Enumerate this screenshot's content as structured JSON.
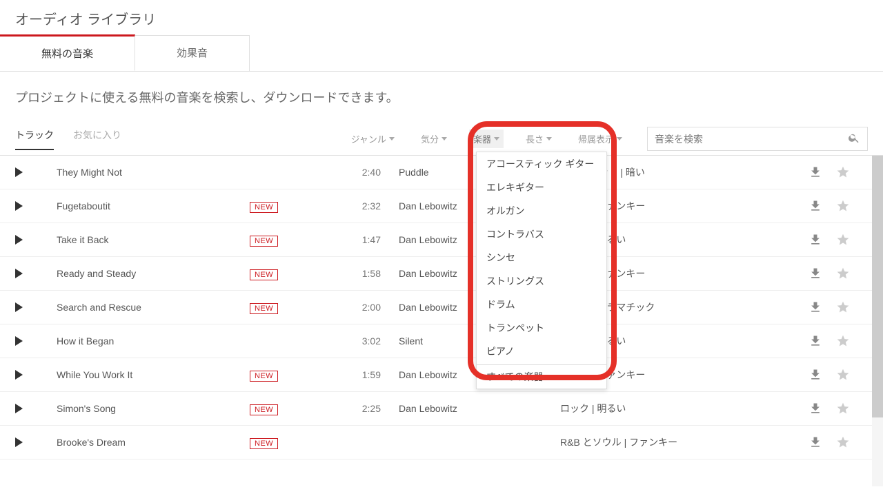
{
  "page_title": "オーディオ ライブラリ",
  "tabs": [
    {
      "label": "無料の音楽",
      "active": true
    },
    {
      "label": "効果音",
      "active": false
    }
  ],
  "intro": "プロジェクトに使える無料の音楽を検索し、ダウンロードできます。",
  "sub_tabs": [
    {
      "label": "トラック",
      "active": true
    },
    {
      "label": "お気に入り",
      "active": false
    }
  ],
  "filters": {
    "genre": "ジャンル",
    "mood": "気分",
    "instrument": "楽器",
    "length": "長さ",
    "license": "帰属表示"
  },
  "search_placeholder": "音楽を検索",
  "instrument_menu": [
    "アコースティック ギター",
    "エレキギター",
    "オルガン",
    "コントラバス",
    "シンセ",
    "ストリングス",
    "ドラム",
    "トランペット",
    "ピアノ"
  ],
  "instrument_menu_all": "すべての楽器",
  "tracks": [
    {
      "title": "They Might Not",
      "new": false,
      "duration": "2:40",
      "artist": "Puddle",
      "tags": "アンビエント | 暗い"
    },
    {
      "title": "Fugetaboutit",
      "new": true,
      "duration": "2:32",
      "artist": "Dan Lebowitz",
      "tags": "ロック | ファンキー"
    },
    {
      "title": "Take it Back",
      "new": true,
      "duration": "1:47",
      "artist": "Dan Lebowitz",
      "tags": "ロック | 明るい"
    },
    {
      "title": "Ready and Steady",
      "new": true,
      "duration": "1:58",
      "artist": "Dan Lebowitz",
      "tags": "ロック | ファンキー"
    },
    {
      "title": "Search and Rescue",
      "new": true,
      "duration": "2:00",
      "artist": "Dan Lebowitz",
      "tags": "ロック | ドラマチック"
    },
    {
      "title": "How it Began",
      "new": false,
      "duration": "3:02",
      "artist": "Silent",
      "tags": "ポップ | 明るい"
    },
    {
      "title": "While You Work It",
      "new": true,
      "duration": "1:59",
      "artist": "Dan Lebowitz",
      "tags": "ロック | ファンキー"
    },
    {
      "title": "Simon's Song",
      "new": true,
      "duration": "2:25",
      "artist": "Dan Lebowitz",
      "tags": "ロック | 明るい"
    },
    {
      "title": "Brooke's Dream",
      "new": true,
      "duration": "",
      "artist": "",
      "tags": "R&B とソウル | ファンキー"
    }
  ],
  "new_badge": "NEW"
}
